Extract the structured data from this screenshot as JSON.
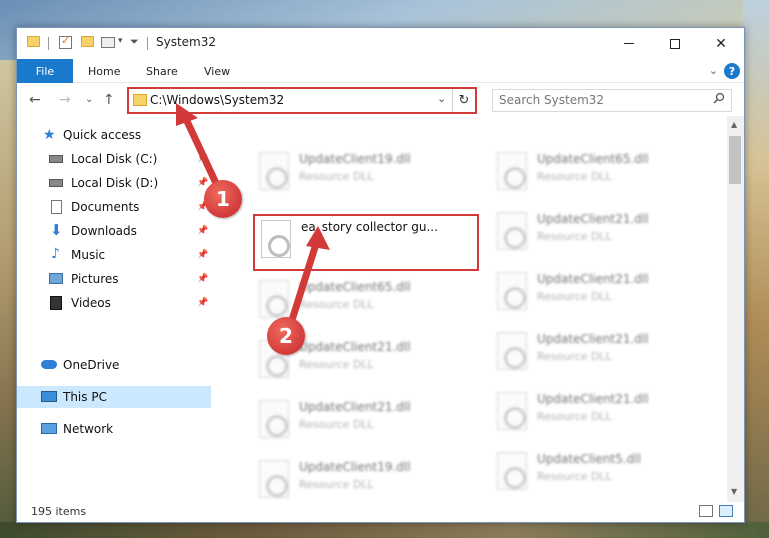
{
  "window": {
    "title": "System32",
    "controls": {
      "minimize": "—",
      "maximize": "☐",
      "close": "✕"
    }
  },
  "ribbon": {
    "tabs": [
      "File",
      "Home",
      "Share",
      "View"
    ],
    "collapse": "⌄",
    "help": "?"
  },
  "address_bar": {
    "path": "C:\\Windows\\System32",
    "dropdown": "⌄",
    "refresh": "↻"
  },
  "search": {
    "placeholder": "Search System32",
    "icon": "search-icon"
  },
  "navigation": {
    "back": "←",
    "forward": "→",
    "recent": "⌄",
    "up": "↑"
  },
  "sidebar": {
    "quick_access": "Quick access",
    "items": [
      {
        "label": "Local Disk (C:)",
        "icon": "drive-icon",
        "pinned": true
      },
      {
        "label": "Local Disk (D:)",
        "icon": "drive-icon",
        "pinned": true
      },
      {
        "label": "Documents",
        "icon": "documents-icon",
        "pinned": true
      },
      {
        "label": "Downloads",
        "icon": "downloads-icon",
        "pinned": true
      },
      {
        "label": "Music",
        "icon": "music-icon",
        "pinned": true
      },
      {
        "label": "Pictures",
        "icon": "pictures-icon",
        "pinned": true
      },
      {
        "label": "Videos",
        "icon": "videos-icon",
        "pinned": true
      }
    ],
    "onedrive": "OneDrive",
    "this_pc": "This PC",
    "network": "Network"
  },
  "files": {
    "highlighted": {
      "name": "ea_story collector gu...",
      "type": ""
    },
    "left_column": [
      {
        "name": "UpdateClient19.dll",
        "type": "Resource DLL"
      },
      {
        "name": "UpdateClient65.dll",
        "type": "Resource DLL"
      },
      {
        "name": "UpdateClient21.dll",
        "type": "Resource DLL"
      },
      {
        "name": "UpdateClient21.dll",
        "type": "Resource DLL"
      },
      {
        "name": "UpdateClient19.dll",
        "type": "Resource DLL"
      }
    ],
    "right_column": [
      {
        "name": "UpdateClient65.dll",
        "type": "Resource DLL"
      },
      {
        "name": "UpdateClient21.dll",
        "type": "Resource DLL"
      },
      {
        "name": "UpdateClient21.dll",
        "type": "Resource DLL"
      },
      {
        "name": "UpdateClient21.dll",
        "type": "Resource DLL"
      },
      {
        "name": "UpdateClient21.dll",
        "type": "Resource DLL"
      },
      {
        "name": "UpdateClient5.dll",
        "type": "Resource DLL"
      }
    ]
  },
  "status_bar": {
    "item_count": "195 items"
  },
  "annotations": {
    "step1": "1",
    "step2": "2",
    "color": "#d23a3a"
  }
}
